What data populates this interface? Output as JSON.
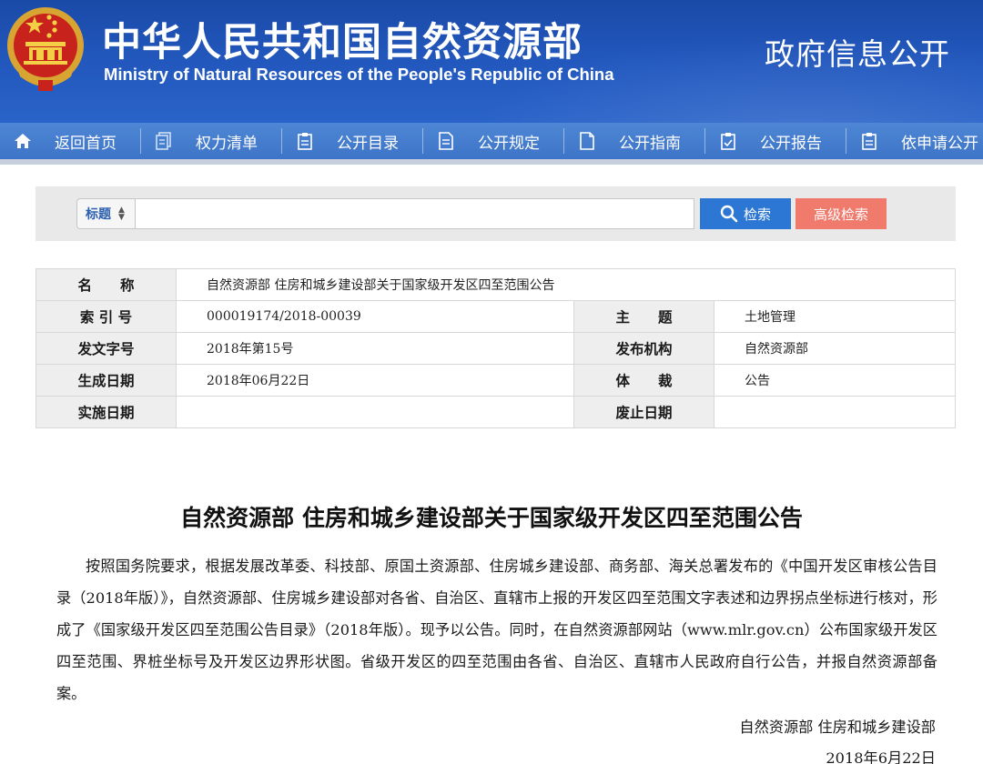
{
  "header": {
    "site_title_cn": "中华人民共和国自然资源部",
    "site_title_en": "Ministry of Natural Resources of the People's Republic of China",
    "portal_name": "政府信息公开",
    "emblem_icon": "national-emblem"
  },
  "nav": {
    "items": [
      {
        "label": "返回首页",
        "icon": "home-icon"
      },
      {
        "label": "权力清单",
        "icon": "list-doc-icon"
      },
      {
        "label": "公开目录",
        "icon": "catalog-icon"
      },
      {
        "label": "公开规定",
        "icon": "document-icon"
      },
      {
        "label": "公开指南",
        "icon": "guide-icon"
      },
      {
        "label": "公开报告",
        "icon": "report-icon"
      },
      {
        "label": "依申请公开",
        "icon": "apply-icon"
      }
    ]
  },
  "search": {
    "field_selected": "标题",
    "input_value": "",
    "search_label": "检索",
    "advanced_label": "高级检索"
  },
  "meta": {
    "name_label": "名　　称",
    "name_value": "自然资源部 住房和城乡建设部关于国家级开发区四至范围公告",
    "index_label": "索 引 号",
    "index_value": "000019174/2018-00039",
    "topic_label": "主　　题",
    "topic_value": "土地管理",
    "docno_label": "发文字号",
    "docno_value": "2018年第15号",
    "issuer_label": "发布机构",
    "issuer_value": "自然资源部",
    "created_label": "生成日期",
    "created_value": "2018年06月22日",
    "genre_label": "体　　裁",
    "genre_value": "公告",
    "effective_label": "实施日期",
    "effective_value": "",
    "expiry_label": "废止日期",
    "expiry_value": ""
  },
  "article": {
    "title": "自然资源部 住房和城乡建设部关于国家级开发区四至范围公告",
    "body": "按照国务院要求，根据发展改革委、科技部、原国土资源部、住房城乡建设部、商务部、海关总署发布的《中国开发区审核公告目录（2018年版）》，自然资源部、住房城乡建设部对各省、自治区、直辖市上报的开发区四至范围文字表述和边界拐点坐标进行核对，形成了《国家级开发区四至范围公告目录》（2018年版）。现予以公告。同时，在自然资源部网站（www.mlr.gov.cn）公布国家级开发区四至范围、界桩坐标号及开发区边界形状图。省级开发区的四至范围由各省、自治区、直辖市人民政府自行公告，并报自然资源部备案。",
    "signer": "自然资源部 住房和城乡建设部",
    "date": "2018年6月22日"
  },
  "colors": {
    "banner": "#2359bf",
    "nav": "#4580cf",
    "search_button": "#2c77d3",
    "advanced_button": "#f07a6c"
  }
}
